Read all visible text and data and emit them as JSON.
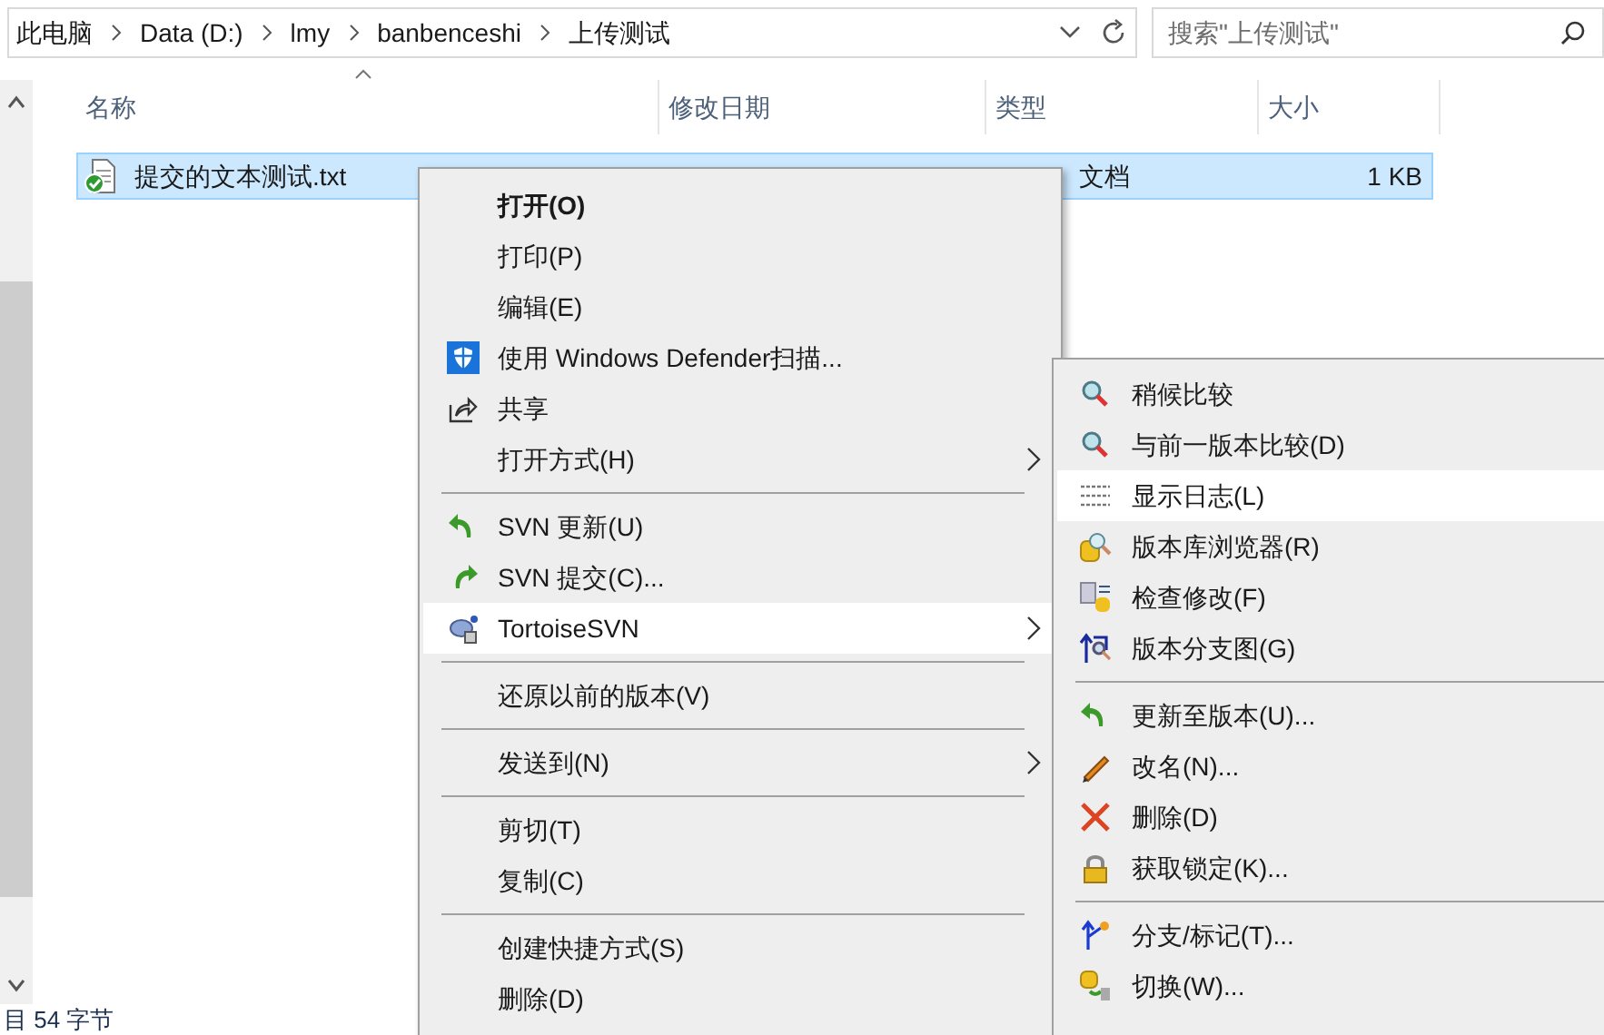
{
  "address_bar": {
    "breadcrumbs": [
      "此电脑",
      "Data (D:)",
      "lmy",
      "banbenceshi",
      "上传测试"
    ]
  },
  "search": {
    "placeholder": "搜索\"上传测试\""
  },
  "columns": [
    {
      "label": "名称",
      "sorted": true
    },
    {
      "label": "修改日期",
      "sorted": false
    },
    {
      "label": "类型",
      "sorted": false
    },
    {
      "label": "大小",
      "sorted": false
    }
  ],
  "files": [
    {
      "name": "提交的文本测试.txt",
      "type": "文档",
      "size": "1 KB",
      "selected": true
    }
  ],
  "context_menu": {
    "items": [
      {
        "kind": "item",
        "label": "打开(O)",
        "default": true,
        "submenu": false,
        "selected": false
      },
      {
        "kind": "item",
        "label": "打印(P)",
        "default": false,
        "submenu": false,
        "selected": false
      },
      {
        "kind": "item",
        "label": "编辑(E)",
        "default": false,
        "submenu": false,
        "selected": false
      },
      {
        "kind": "item",
        "label": "使用 Windows Defender扫描...",
        "default": false,
        "submenu": false,
        "selected": false
      },
      {
        "kind": "item",
        "label": "共享",
        "default": false,
        "submenu": false,
        "selected": false
      },
      {
        "kind": "item",
        "label": "打开方式(H)",
        "default": false,
        "submenu": true,
        "selected": false
      },
      {
        "kind": "separator"
      },
      {
        "kind": "item",
        "label": "SVN 更新(U)",
        "default": false,
        "submenu": false,
        "selected": false
      },
      {
        "kind": "item",
        "label": "SVN 提交(C)...",
        "default": false,
        "submenu": false,
        "selected": false
      },
      {
        "kind": "item",
        "label": "TortoiseSVN",
        "default": false,
        "submenu": true,
        "selected": true
      },
      {
        "kind": "separator"
      },
      {
        "kind": "item",
        "label": "还原以前的版本(V)",
        "default": false,
        "submenu": false,
        "selected": false
      },
      {
        "kind": "separator"
      },
      {
        "kind": "item",
        "label": "发送到(N)",
        "default": false,
        "submenu": true,
        "selected": false
      },
      {
        "kind": "separator"
      },
      {
        "kind": "item",
        "label": "剪切(T)",
        "default": false,
        "submenu": false,
        "selected": false
      },
      {
        "kind": "item",
        "label": "复制(C)",
        "default": false,
        "submenu": false,
        "selected": false
      },
      {
        "kind": "separator"
      },
      {
        "kind": "item",
        "label": "创建快捷方式(S)",
        "default": false,
        "submenu": false,
        "selected": false
      },
      {
        "kind": "item",
        "label": "删除(D)",
        "default": false,
        "submenu": false,
        "selected": false
      }
    ]
  },
  "submenu": {
    "items": [
      {
        "kind": "item",
        "label": "稍候比较",
        "selected": false
      },
      {
        "kind": "item",
        "label": "与前一版本比较(D)",
        "selected": false
      },
      {
        "kind": "item",
        "label": "显示日志(L)",
        "selected": true
      },
      {
        "kind": "item",
        "label": "版本库浏览器(R)",
        "selected": false
      },
      {
        "kind": "item",
        "label": "检查修改(F)",
        "selected": false
      },
      {
        "kind": "item",
        "label": "版本分支图(G)",
        "selected": false
      },
      {
        "kind": "separator"
      },
      {
        "kind": "item",
        "label": "更新至版本(U)...",
        "selected": false
      },
      {
        "kind": "item",
        "label": "改名(N)...",
        "selected": false
      },
      {
        "kind": "item",
        "label": "删除(D)",
        "selected": false
      },
      {
        "kind": "item",
        "label": "获取锁定(K)...",
        "selected": false
      },
      {
        "kind": "separator"
      },
      {
        "kind": "item",
        "label": "分支/标记(T)...",
        "selected": false
      },
      {
        "kind": "item",
        "label": "切换(W)...",
        "selected": false
      }
    ]
  },
  "status_bar": {
    "text": "目 54 字节"
  }
}
